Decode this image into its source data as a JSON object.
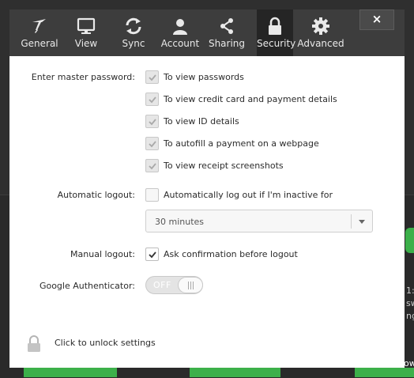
{
  "tabs": [
    {
      "label": "General",
      "icon": "general-icon"
    },
    {
      "label": "View",
      "icon": "monitor-icon"
    },
    {
      "label": "Sync",
      "icon": "sync-icon"
    },
    {
      "label": "Account",
      "icon": "user-icon"
    },
    {
      "label": "Sharing",
      "icon": "share-icon"
    },
    {
      "label": "Security",
      "icon": "lock-icon",
      "active": true
    },
    {
      "label": "Advanced",
      "icon": "gear-icon"
    }
  ],
  "close_label": "×",
  "security": {
    "master_password_label": "Enter master password:",
    "master_password_options": [
      {
        "label": "To view passwords",
        "checked": true,
        "disabled": true
      },
      {
        "label": "To view credit card and payment details",
        "checked": true,
        "disabled": true
      },
      {
        "label": "To view ID details",
        "checked": true,
        "disabled": true
      },
      {
        "label": "To autofill a payment on a webpage",
        "checked": true,
        "disabled": true
      },
      {
        "label": "To view receipt screenshots",
        "checked": true,
        "disabled": true
      }
    ],
    "auto_logout_label": "Automatic logout:",
    "auto_logout_option": {
      "label": "Automatically log out if I'm inactive for",
      "checked": false
    },
    "auto_logout_duration": "30 minutes",
    "manual_logout_label": "Manual logout:",
    "manual_logout_option": {
      "label": "Ask confirmation before logout",
      "checked": true
    },
    "google_auth_label": "Google Authenticator:",
    "google_auth_state": "OFF",
    "unlock_text": "Click to unlock settings"
  },
  "background": {
    "fragments": [
      "1:",
      "sw",
      "ng",
      "ow"
    ]
  },
  "colors": {
    "toolbar": "#3d3d3d",
    "active_tab": "#252525",
    "accent_green": "#3cb04a"
  }
}
